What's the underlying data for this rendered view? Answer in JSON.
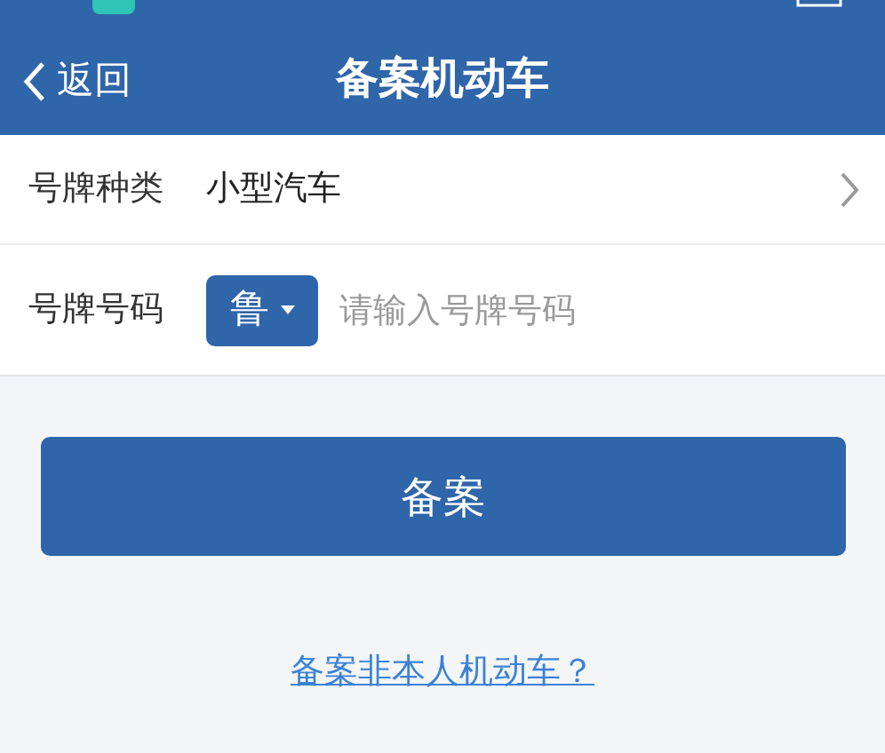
{
  "nav_bar": {
    "back": "返回",
    "title": "备案机动车"
  },
  "form": {
    "plate_type": {
      "label": "号牌种类",
      "value": "小型汽车"
    },
    "plate_number": {
      "label": "号牌号码",
      "province": "鲁",
      "placeholder": "请输入号牌号码"
    }
  },
  "submit_button": "备案",
  "link": "备案非本人机动车？"
}
